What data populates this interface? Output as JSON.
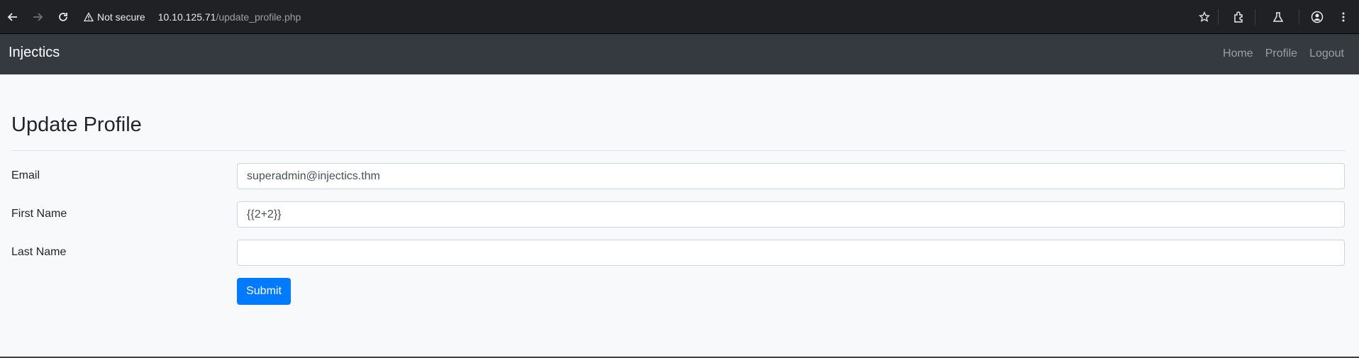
{
  "browser": {
    "security_label": "Not secure",
    "url_host": "10.10.125.71",
    "url_path": "/update_profile.php"
  },
  "navbar": {
    "brand": "Injectics",
    "links": [
      "Home",
      "Profile",
      "Logout"
    ]
  },
  "page": {
    "title": "Update Profile"
  },
  "form": {
    "email_label": "Email",
    "email_value": "superadmin@injectics.thm",
    "first_name_label": "First Name",
    "first_name_value": "{{2+2}}",
    "last_name_label": "Last Name",
    "last_name_value": "",
    "submit_label": "Submit"
  },
  "colors": {
    "primary": "#007bff",
    "navbar_bg": "#343a40",
    "page_bg": "#f8f9fa"
  }
}
